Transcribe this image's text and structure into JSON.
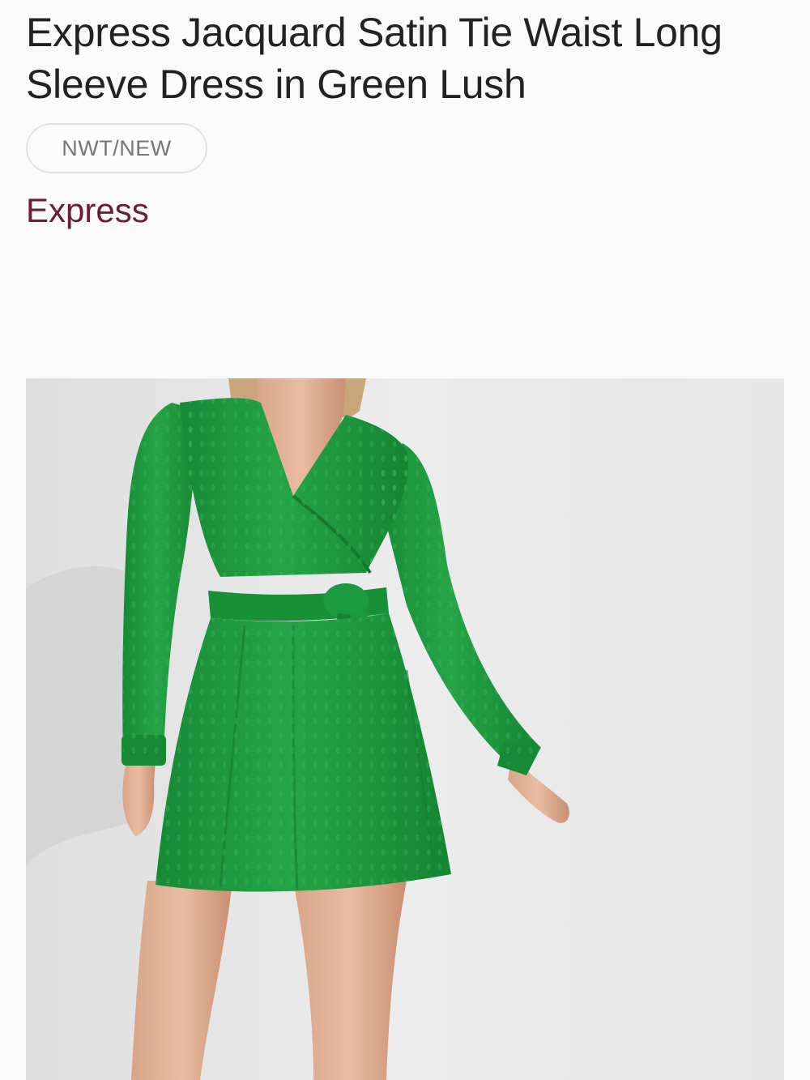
{
  "listing": {
    "title": "Express Jacquard Satin Tie Waist Long Sleeve Dress in Green Lush",
    "condition": "NWT/NEW",
    "brand": "Express"
  },
  "colors": {
    "brand": "#6b1e36",
    "dress": "#1f9a3f",
    "background": "#fafafa",
    "photo_background": "#e9e9e9"
  },
  "photo": {
    "subject": "green-long-sleeve-dress-model"
  }
}
